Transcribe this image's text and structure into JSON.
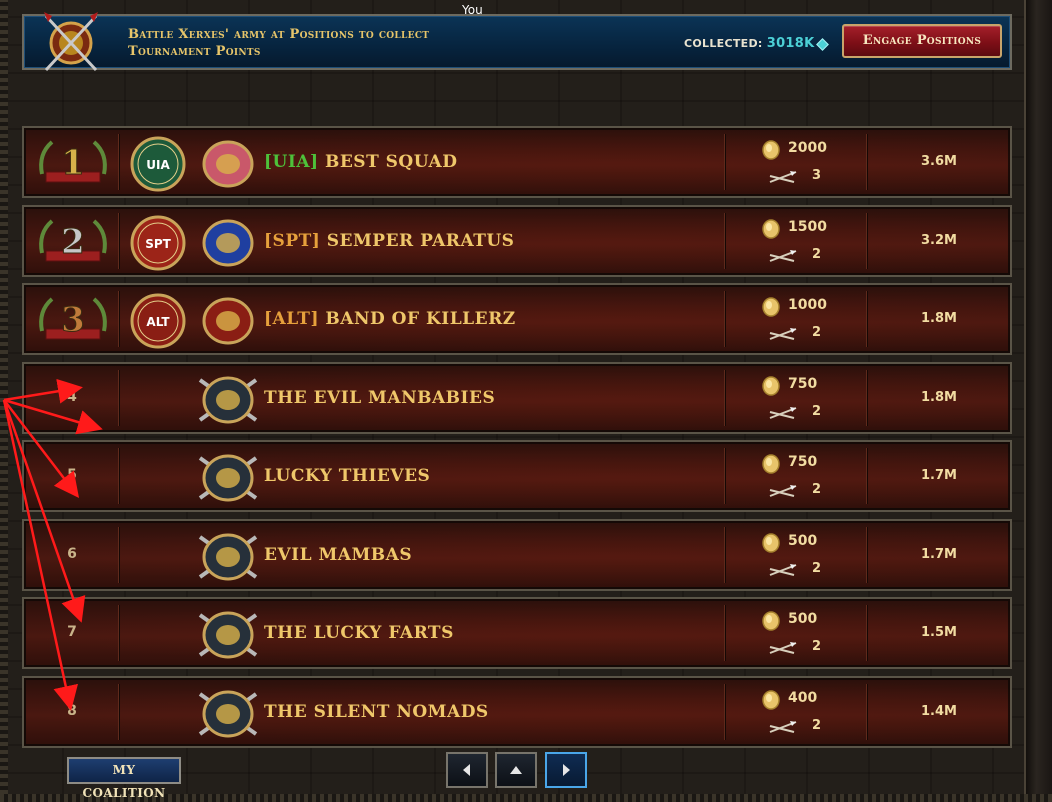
{
  "header": {
    "you_label": "You"
  },
  "banner": {
    "text_line1": "Battle Xerxes' army at Positions to collect",
    "text_line2": "Tournament Points",
    "collected_label": "COLLECTED:",
    "collected_value": "3018K",
    "engage_label": "Engage Positions"
  },
  "leaderboard": {
    "rows": [
      {
        "rank": "1",
        "tag_badge": "UIA",
        "tag": "[UIA]",
        "name": "BEST SQUAD",
        "tag_color": "green",
        "reward": "2000",
        "count": "3",
        "points": "3.6M"
      },
      {
        "rank": "2",
        "tag_badge": "SPT",
        "tag": "[SPT]",
        "name": "SEMPER  PARATUS",
        "tag_color": "orange",
        "reward": "1500",
        "count": "2",
        "points": "3.2M"
      },
      {
        "rank": "3",
        "tag_badge": "ALT",
        "tag": "[ALT]",
        "name": "BAND OF KILLERZ",
        "tag_color": "orange",
        "reward": "1000",
        "count": "2",
        "points": "1.8M"
      },
      {
        "rank": "4",
        "tag": "",
        "name": "THE EVIL MANBABIES",
        "reward": "750",
        "count": "2",
        "points": "1.8M"
      },
      {
        "rank": "5",
        "tag": "",
        "name": "LUCKY THIEVES",
        "reward": "750",
        "count": "2",
        "points": "1.7M"
      },
      {
        "rank": "6",
        "tag": "",
        "name": "EVIL MAMBAS",
        "reward": "500",
        "count": "2",
        "points": "1.7M"
      },
      {
        "rank": "7",
        "tag": "",
        "name": "THE LUCKY FARTS",
        "reward": "500",
        "count": "2",
        "points": "1.5M"
      },
      {
        "rank": "8",
        "tag": "",
        "name": "THE SILENT NOMADS",
        "reward": "400",
        "count": "2",
        "points": "1.4M"
      }
    ]
  },
  "footer": {
    "coalition_label": "MY COALITION",
    "prev_icon": "triangle-left-icon",
    "top_icon": "triangle-up-icon",
    "next_icon": "triangle-right-icon"
  },
  "colors": {
    "banner_bg": "#072540",
    "engage_bg": "#7e0f17",
    "row_bg": "#3d140e",
    "name_gold": "#efc76a",
    "tag_green": "#4ec13a",
    "tag_orange": "#e6a13c",
    "collected_cyan": "#4cd0d6",
    "annotation_red": "#ff1a1a"
  }
}
